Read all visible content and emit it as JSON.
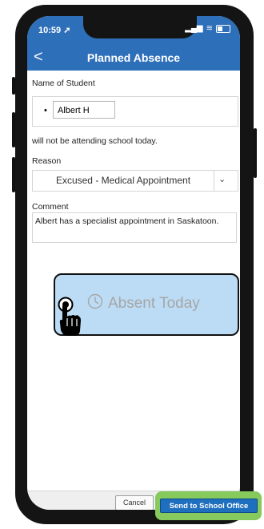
{
  "status_bar": {
    "time": "10:59"
  },
  "nav": {
    "back_glyph": "<",
    "title": "Planned Absence"
  },
  "form": {
    "student_label": "Name of Student",
    "student_bullet": "•",
    "student_name": "Albert H",
    "sentence": "will not be attending school today.",
    "reason_label": "Reason",
    "reason_value": "Excused - Medical Appointment",
    "comment_label": "Comment",
    "comment_value": "Albert has a specialist appointment in Saskatoon."
  },
  "absent_button": {
    "label": "Absent Today",
    "icon": "clock-icon",
    "fill_color": "#bcdcf6"
  },
  "cursor": {
    "icon": "pointing-hand-icon"
  },
  "footer": {
    "cancel_label": "Cancel",
    "send_label": "Send to School Office"
  },
  "colors": {
    "header": "#2e6fba",
    "send_button": "#1f6fbf",
    "highlight": "#86c95c"
  }
}
